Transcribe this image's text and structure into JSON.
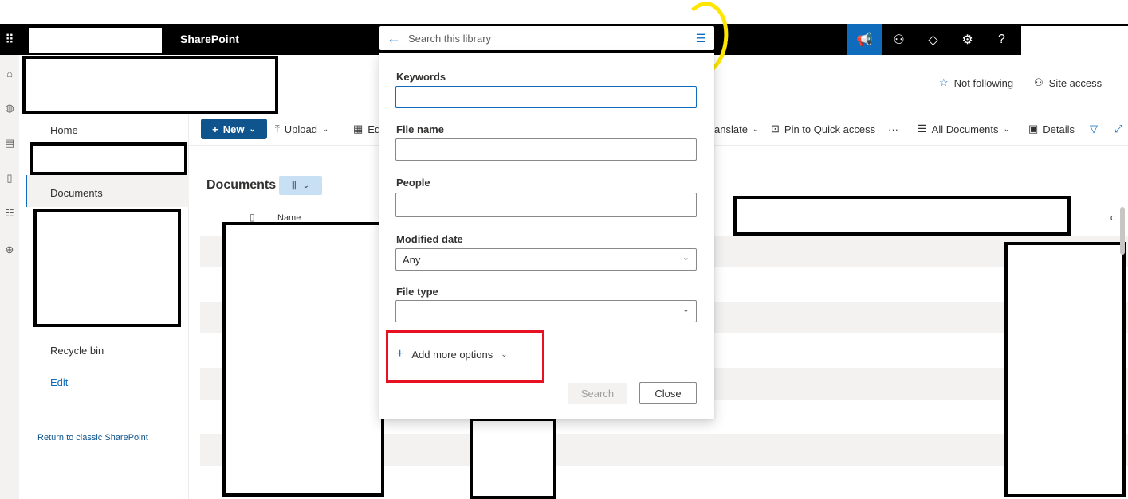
{
  "suite_bar": {
    "app_name": "SharePoint",
    "search_placeholder": "Search this library"
  },
  "header": {
    "not_following": "Not following",
    "site_access": "Site access"
  },
  "left_nav": {
    "items": [
      {
        "label": "Home"
      },
      {
        "label": "Documents"
      },
      {
        "label": "Recycle bin"
      },
      {
        "label": "Edit"
      }
    ],
    "return_classic": "Return to classic SharePoint"
  },
  "command_bar": {
    "new_label": "New",
    "upload_label": "Upload",
    "edit_partial": "Ed",
    "translate_partial": "anslate",
    "pin_label": "Pin to Quick access",
    "more_label": "···",
    "view_label": "All Documents",
    "details_label": "Details"
  },
  "library": {
    "title": "Documents",
    "column_name": "Name",
    "column_partial": "c"
  },
  "search_panel": {
    "keywords_label": "Keywords",
    "keywords_value": "",
    "file_name_label": "File name",
    "people_label": "People",
    "modified_date_label": "Modified date",
    "modified_date_value": "Any",
    "file_type_label": "File type",
    "file_type_value": "",
    "add_more_options": "Add more options",
    "search_button": "Search",
    "close_button": "Close"
  },
  "colors": {
    "accent": "#0f6cbd",
    "new_button": "#0f548c",
    "suite_bar": "#000000",
    "highlight_red": "#e81123",
    "highlight_yellow": "#ffe600"
  }
}
